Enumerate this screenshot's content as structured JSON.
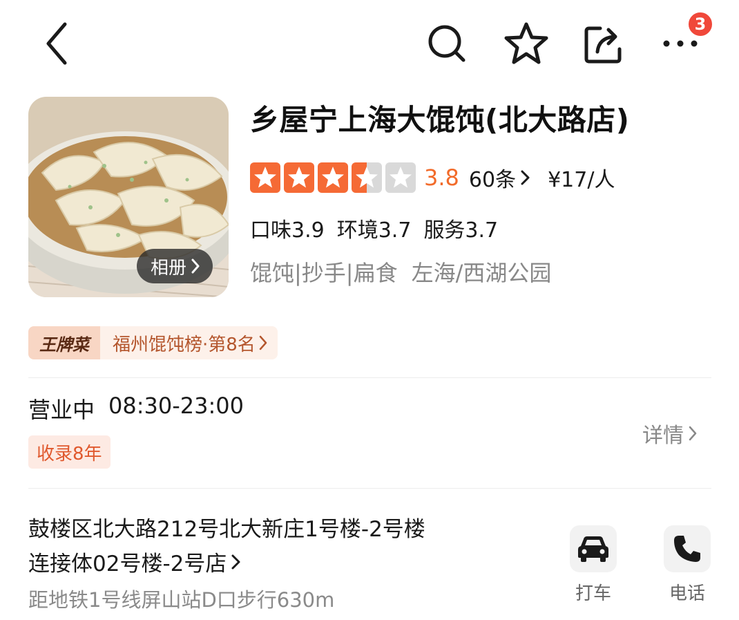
{
  "topbar": {
    "back_icon": "chevron-left-icon",
    "search_icon": "search-icon",
    "favorite_icon": "star-outline-icon",
    "share_icon": "share-icon",
    "more_icon": "more-dots-icon",
    "notification_count": "3"
  },
  "shop": {
    "name": "乡屋宁上海大馄饨(北大路店)",
    "album_label": "相册",
    "rating": "3.8",
    "rating_value": 3.5,
    "stars_filled": 3.5,
    "stars_total": 5,
    "review_count": "60条",
    "price": "¥17/人",
    "taste_score": "口味3.9",
    "environment_score": "环境3.7",
    "service_score": "服务3.7",
    "categories": "馄饨|抄手|扁食",
    "area": "左海/西湖公园"
  },
  "ranking": {
    "badge": "王牌菜",
    "text": "福州馄饨榜·第8名"
  },
  "hours": {
    "status": "营业中",
    "time": "08:30-23:00",
    "years_tag": "收录8年",
    "details_label": "详情"
  },
  "address": {
    "line1": "鼓楼区北大路212号北大新庄1号楼-2号楼",
    "line2": "连接体02号楼-2号店",
    "metro": "距地铁1号线屏山站D口步行630m"
  },
  "actions": {
    "taxi_label": "打车",
    "phone_label": "电话"
  },
  "colors": {
    "accent_orange": "#f26b2a",
    "star_orange": "#f56a35",
    "star_gray": "#d9d9d9",
    "badge_red": "#f0483a"
  }
}
